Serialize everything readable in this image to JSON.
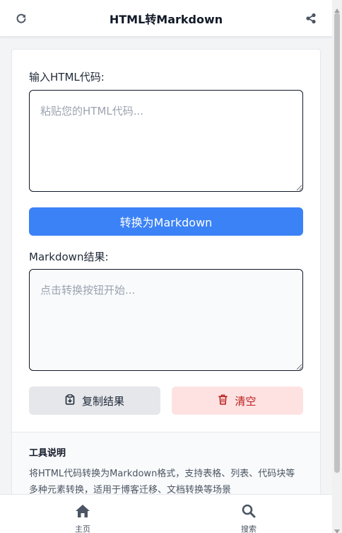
{
  "header": {
    "title": "HTML转Markdown",
    "refresh_icon": "refresh-icon",
    "share_icon": "share-icon"
  },
  "converter": {
    "input_label": "输入HTML代码:",
    "input_placeholder": "粘贴您的HTML代码...",
    "input_value": "",
    "convert_label": "转换为Markdown",
    "output_label": "Markdown结果:",
    "output_placeholder": "点击转换按钮开始...",
    "output_value": "",
    "copy_label": "复制结果",
    "copy_icon": "clipboard-icon",
    "clear_label": "清空",
    "clear_icon": "trash-icon"
  },
  "info": {
    "title": "工具说明",
    "description": "将HTML代码转换为Markdown格式，支持表格、列表、代码块等多种元素转换，适用于博客迁移、文档转换等场景"
  },
  "bottom_nav": {
    "items": [
      {
        "label": "主页",
        "icon": "home-icon"
      },
      {
        "label": "搜索",
        "icon": "search-icon"
      }
    ]
  },
  "colors": {
    "primary": "#3b82f6",
    "danger_bg": "#fee2e2",
    "danger_text": "#b91c1c",
    "neutral_bg": "#e5e7eb"
  }
}
